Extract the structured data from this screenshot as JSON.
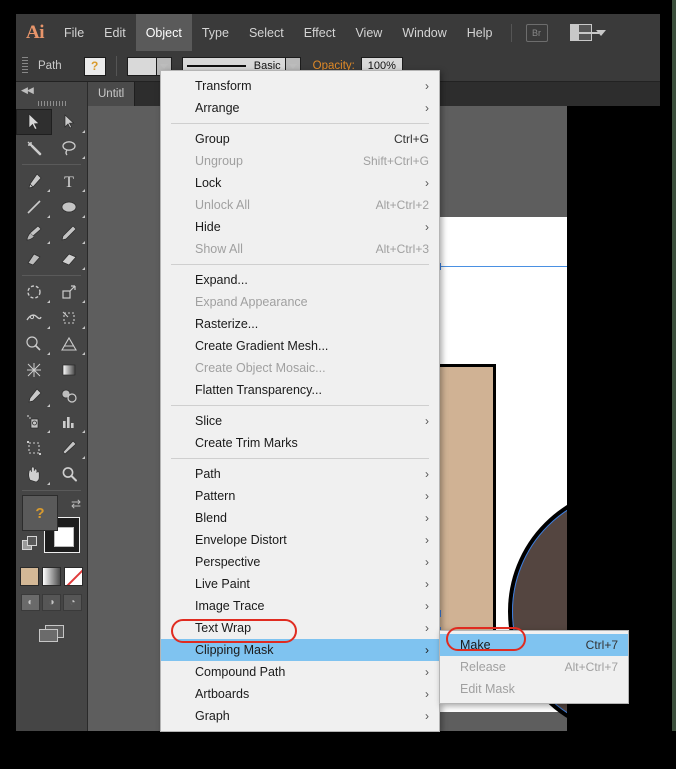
{
  "app": {
    "name": "Ai",
    "logo_text": "Ai"
  },
  "menubar": {
    "items": [
      {
        "label": "File",
        "active": false
      },
      {
        "label": "Edit",
        "active": false
      },
      {
        "label": "Object",
        "active": true
      },
      {
        "label": "Type",
        "active": false
      },
      {
        "label": "Select",
        "active": false
      },
      {
        "label": "Effect",
        "active": false
      },
      {
        "label": "View",
        "active": false
      },
      {
        "label": "Window",
        "active": false
      },
      {
        "label": "Help",
        "active": false
      }
    ],
    "bridge_label": "Br",
    "arrange_icon": "arrange-documents-icon"
  },
  "controlbar": {
    "object_type": "Path",
    "fill_swatch": "?",
    "stroke_profile": "Basic",
    "opacity_label": "Opacity:",
    "opacity_value": "100%"
  },
  "document": {
    "tab_title": "Untitl"
  },
  "toolpanel": {
    "collapse_label": "◀◀",
    "tools": [
      {
        "name": "selection-tool",
        "glyph": "⬉",
        "selected": true
      },
      {
        "name": "direct-selection-tool",
        "glyph": "⬉",
        "selected": false
      },
      {
        "name": "magic-wand-tool",
        "glyph": "✳",
        "selected": false
      },
      {
        "name": "lasso-tool",
        "glyph": "➰",
        "selected": false
      },
      {
        "name": "pen-tool",
        "glyph": "✒",
        "selected": false
      },
      {
        "name": "type-tool",
        "glyph": "T",
        "selected": false
      },
      {
        "name": "line-segment-tool",
        "glyph": "╱",
        "selected": false
      },
      {
        "name": "ellipse-tool",
        "glyph": "⬭",
        "selected": false
      },
      {
        "name": "paintbrush-tool",
        "glyph": "὘C",
        "selected": false
      },
      {
        "name": "pencil-tool",
        "glyph": "✏",
        "selected": false
      },
      {
        "name": "blob-brush-tool",
        "glyph": "◢",
        "selected": false
      },
      {
        "name": "eraser-tool",
        "glyph": "▱",
        "selected": false
      },
      {
        "name": "rotate-tool",
        "glyph": "↻",
        "selected": false
      },
      {
        "name": "scale-tool",
        "glyph": "⬌",
        "selected": false
      },
      {
        "name": "width-tool",
        "glyph": "⧉",
        "selected": false
      },
      {
        "name": "free-transform-tool",
        "glyph": "⬚",
        "selected": false
      },
      {
        "name": "shape-builder-tool",
        "glyph": "◔",
        "selected": false
      },
      {
        "name": "perspective-grid-tool",
        "glyph": "◥",
        "selected": false
      },
      {
        "name": "mesh-tool",
        "glyph": "⌗",
        "selected": false
      },
      {
        "name": "gradient-tool",
        "glyph": "▤",
        "selected": false
      },
      {
        "name": "eyedropper-tool",
        "glyph": "⚗",
        "selected": false
      },
      {
        "name": "blend-tool",
        "glyph": "○",
        "selected": false
      },
      {
        "name": "symbol-sprayer-tool",
        "glyph": "☂",
        "selected": false
      },
      {
        "name": "column-graph-tool",
        "glyph": "█",
        "selected": false
      },
      {
        "name": "artboard-tool",
        "glyph": "⬚",
        "selected": false
      },
      {
        "name": "slice-tool",
        "glyph": "✂",
        "selected": false
      },
      {
        "name": "hand-tool",
        "glyph": "✋",
        "selected": false
      },
      {
        "name": "zoom-tool",
        "glyph": "ὐD",
        "selected": false
      }
    ],
    "fill_stroke": {
      "fill_label": "?",
      "swap_icon": "swap-fill-stroke-icon",
      "default_icon": "default-fill-stroke-icon"
    },
    "swatches": [
      {
        "name": "color-swatch",
        "color": "#d4b896"
      },
      {
        "name": "gradient-swatch",
        "color": "gradient"
      },
      {
        "name": "none-swatch",
        "color": "none"
      }
    ],
    "draw_modes": [
      {
        "name": "draw-normal-mode",
        "glyph": "◰",
        "selected": true
      },
      {
        "name": "draw-behind-mode",
        "glyph": "◴",
        "selected": false
      },
      {
        "name": "draw-inside-mode",
        "glyph": "◔",
        "selected": false
      }
    ],
    "screen_mode_icon": "change-screen-mode-icon"
  },
  "object_menu": {
    "title": "Object",
    "groups": [
      [
        {
          "label": "Transform",
          "shortcut": "",
          "submenu": true,
          "disabled": false,
          "highlight": false
        },
        {
          "label": "Arrange",
          "shortcut": "",
          "submenu": true,
          "disabled": false,
          "highlight": false
        }
      ],
      [
        {
          "label": "Group",
          "shortcut": "Ctrl+G",
          "submenu": false,
          "disabled": false,
          "highlight": false
        },
        {
          "label": "Ungroup",
          "shortcut": "Shift+Ctrl+G",
          "submenu": false,
          "disabled": true,
          "highlight": false
        },
        {
          "label": "Lock",
          "shortcut": "",
          "submenu": true,
          "disabled": false,
          "highlight": false
        },
        {
          "label": "Unlock All",
          "shortcut": "Alt+Ctrl+2",
          "submenu": false,
          "disabled": true,
          "highlight": false
        },
        {
          "label": "Hide",
          "shortcut": "",
          "submenu": true,
          "disabled": false,
          "highlight": false
        },
        {
          "label": "Show All",
          "shortcut": "Alt+Ctrl+3",
          "submenu": false,
          "disabled": true,
          "highlight": false
        }
      ],
      [
        {
          "label": "Expand...",
          "shortcut": "",
          "submenu": false,
          "disabled": false,
          "highlight": false
        },
        {
          "label": "Expand Appearance",
          "shortcut": "",
          "submenu": false,
          "disabled": true,
          "highlight": false
        },
        {
          "label": "Rasterize...",
          "shortcut": "",
          "submenu": false,
          "disabled": false,
          "highlight": false
        },
        {
          "label": "Create Gradient Mesh...",
          "shortcut": "",
          "submenu": false,
          "disabled": false,
          "highlight": false
        },
        {
          "label": "Create Object Mosaic...",
          "shortcut": "",
          "submenu": false,
          "disabled": true,
          "highlight": false
        },
        {
          "label": "Flatten Transparency...",
          "shortcut": "",
          "submenu": false,
          "disabled": false,
          "highlight": false
        }
      ],
      [
        {
          "label": "Slice",
          "shortcut": "",
          "submenu": true,
          "disabled": false,
          "highlight": false
        },
        {
          "label": "Create Trim Marks",
          "shortcut": "",
          "submenu": false,
          "disabled": false,
          "highlight": false
        }
      ],
      [
        {
          "label": "Path",
          "shortcut": "",
          "submenu": true,
          "disabled": false,
          "highlight": false
        },
        {
          "label": "Pattern",
          "shortcut": "",
          "submenu": true,
          "disabled": false,
          "highlight": false
        },
        {
          "label": "Blend",
          "shortcut": "",
          "submenu": true,
          "disabled": false,
          "highlight": false
        },
        {
          "label": "Envelope Distort",
          "shortcut": "",
          "submenu": true,
          "disabled": false,
          "highlight": false
        },
        {
          "label": "Perspective",
          "shortcut": "",
          "submenu": true,
          "disabled": false,
          "highlight": false
        },
        {
          "label": "Live Paint",
          "shortcut": "",
          "submenu": true,
          "disabled": false,
          "highlight": false
        },
        {
          "label": "Image Trace",
          "shortcut": "",
          "submenu": true,
          "disabled": false,
          "highlight": false
        },
        {
          "label": "Text Wrap",
          "shortcut": "",
          "submenu": true,
          "disabled": false,
          "highlight": false
        },
        {
          "label": "Clipping Mask",
          "shortcut": "",
          "submenu": true,
          "disabled": false,
          "highlight": true
        },
        {
          "label": "Compound Path",
          "shortcut": "",
          "submenu": true,
          "disabled": false,
          "highlight": false
        },
        {
          "label": "Artboards",
          "shortcut": "",
          "submenu": true,
          "disabled": false,
          "highlight": false
        },
        {
          "label": "Graph",
          "shortcut": "",
          "submenu": true,
          "disabled": false,
          "highlight": false
        }
      ]
    ]
  },
  "clipping_mask_submenu": {
    "items": [
      {
        "label": "Make",
        "shortcut": "Ctrl+7",
        "disabled": false,
        "highlight": true
      },
      {
        "label": "Release",
        "shortcut": "Alt+Ctrl+7",
        "disabled": true,
        "highlight": false
      },
      {
        "label": "Edit Mask",
        "shortcut": "",
        "disabled": true,
        "highlight": false
      }
    ]
  },
  "canvas": {
    "shapes": [
      {
        "name": "rectangle-shape",
        "fill": "#d0b294",
        "stroke": "#000000"
      },
      {
        "name": "circle-shape",
        "fill": "#544540",
        "stroke": "#000000"
      }
    ],
    "selection_color": "#4a90e2"
  },
  "annotations": [
    {
      "name": "clipping-mask-highlight-ring",
      "color": "#e02b20"
    },
    {
      "name": "make-highlight-ring",
      "color": "#e02b20"
    }
  ]
}
